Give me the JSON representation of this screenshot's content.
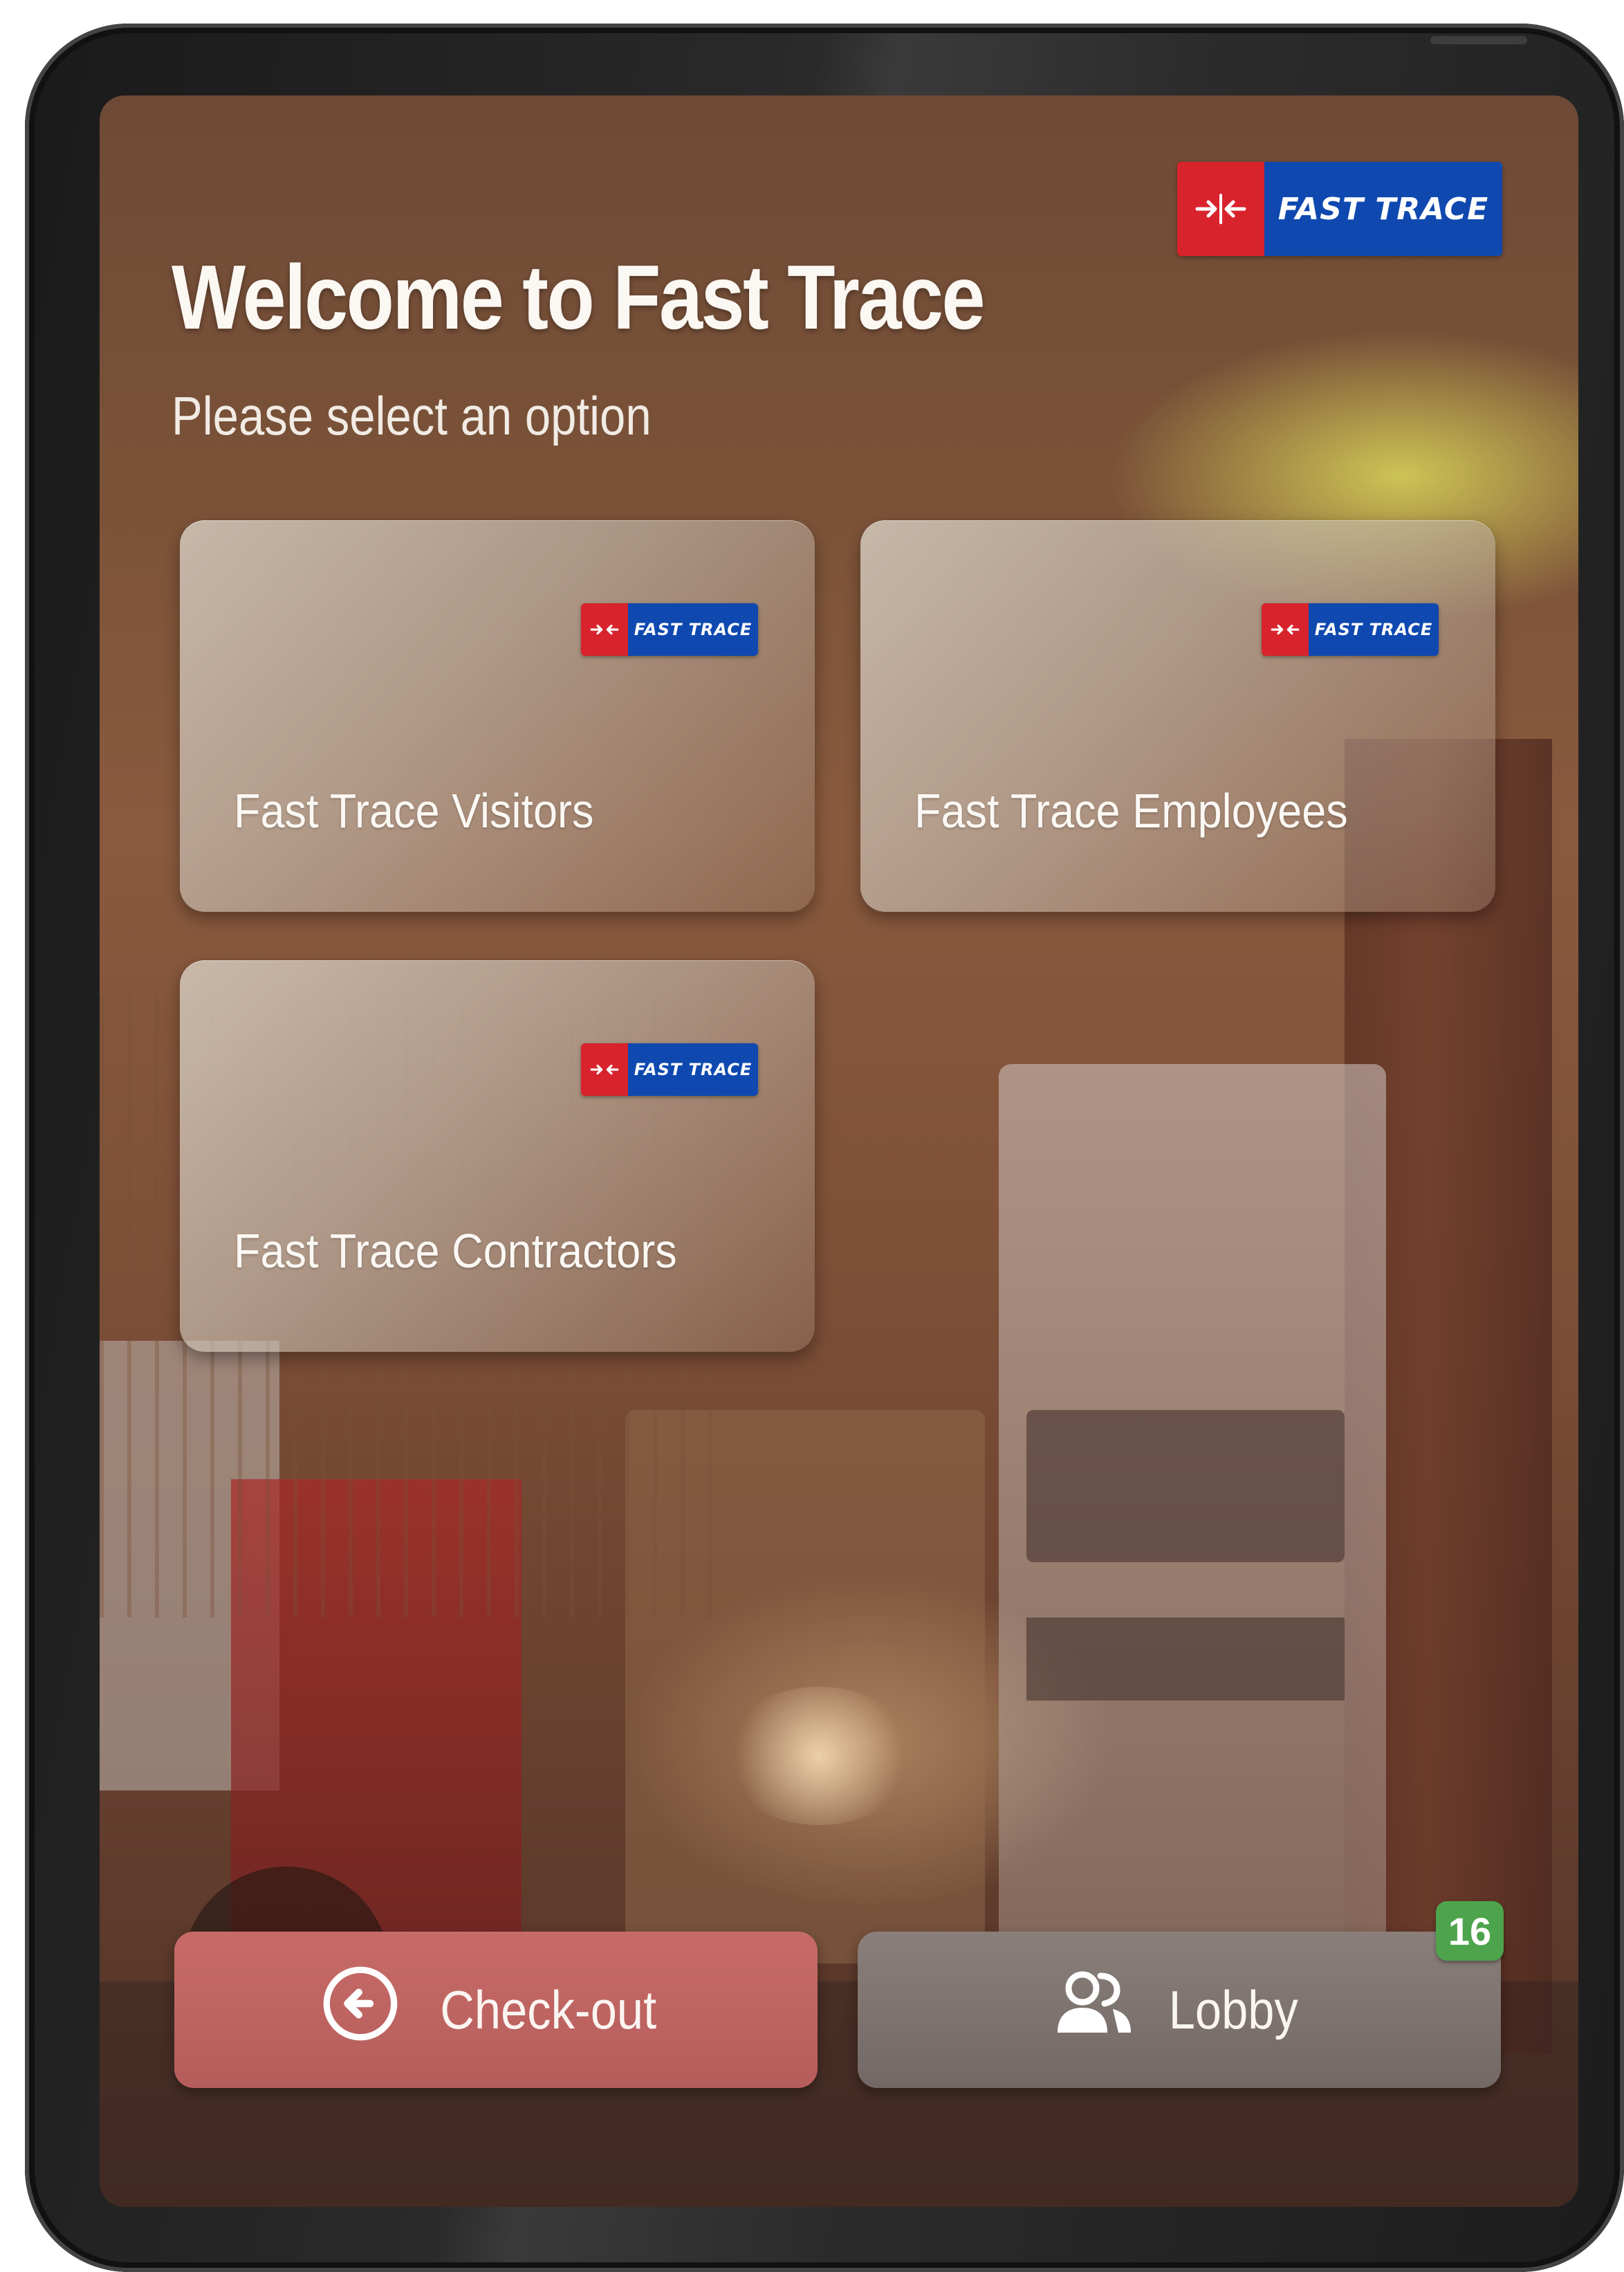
{
  "brand": {
    "logo_text": "FAST TRACE",
    "red": "#d8232d",
    "blue": "#0f49b0"
  },
  "header": {
    "title": "Welcome to Fast Trace",
    "subtitle": "Please select an option"
  },
  "options": [
    {
      "label": "Fast Trace Visitors",
      "logo_text": "FAST TRACE"
    },
    {
      "label": "Fast Trace Employees",
      "logo_text": "FAST TRACE"
    },
    {
      "label": "Fast Trace Contractors",
      "logo_text": "FAST TRACE"
    }
  ],
  "footer": {
    "checkout_label": "Check-out",
    "checkout_icon": "arrow-left-circle-icon",
    "lobby_label": "Lobby",
    "lobby_icon": "people-icon",
    "lobby_count": "16",
    "checkout_color": "#bf6562",
    "lobby_color": "#7e7470",
    "badge_color": "#4ea44c"
  }
}
